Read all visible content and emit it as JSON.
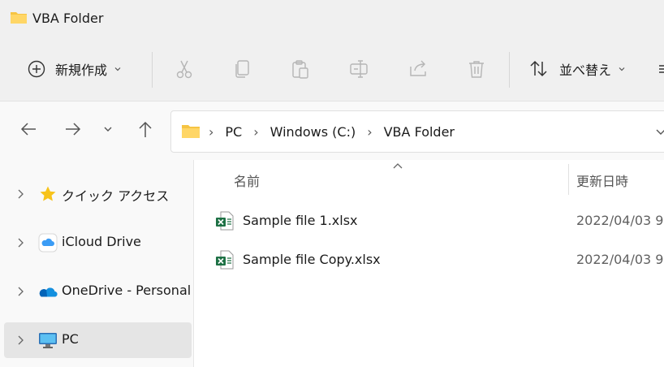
{
  "window": {
    "title": "VBA Folder"
  },
  "toolbar": {
    "new_label": "新規作成",
    "sort_label": "並べ替え",
    "icons": [
      "cut-icon",
      "copy-icon",
      "paste-icon",
      "rename-icon",
      "share-icon",
      "delete-icon"
    ]
  },
  "address": {
    "crumbs": [
      "PC",
      "Windows (C:)",
      "VBA Folder"
    ]
  },
  "sidebar": {
    "items": [
      {
        "label": "クイック アクセス",
        "icon": "star-icon"
      },
      {
        "label": "iCloud Drive",
        "icon": "icloud-icon"
      },
      {
        "label": "OneDrive - Personal",
        "icon": "onedrive-icon"
      },
      {
        "label": "PC",
        "icon": "pc-icon",
        "selected": true
      }
    ]
  },
  "columns": {
    "name": "名前",
    "date": "更新日時"
  },
  "files": [
    {
      "name": "Sample file 1.xlsx",
      "date": "2022/04/03 9"
    },
    {
      "name": "Sample file Copy.xlsx",
      "date": "2022/04/03 9"
    }
  ],
  "colors": {
    "folder": "#f6c443",
    "excel": "#1e7145",
    "selected": "#e5e5e5",
    "onedrive": "#0364b8"
  }
}
